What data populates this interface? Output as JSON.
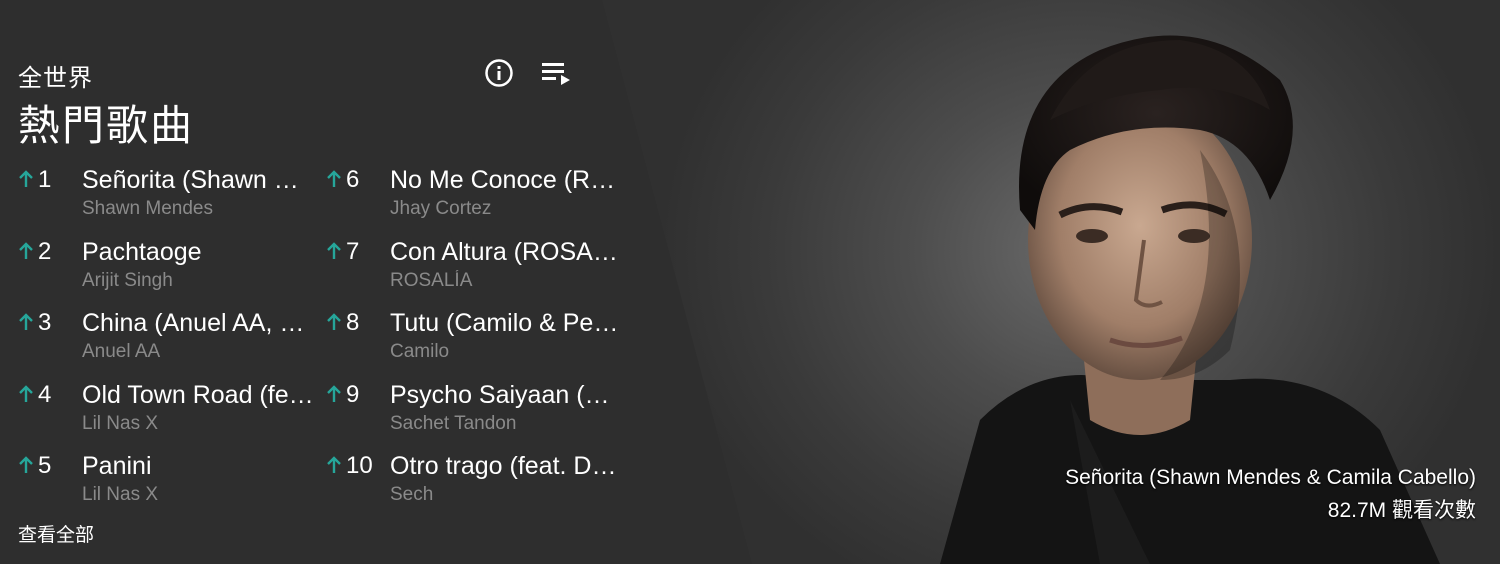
{
  "header": {
    "region": "全世界",
    "title": "熱門歌曲"
  },
  "icons": {
    "info": "info-icon",
    "queue": "playlist-play-icon",
    "rank_change": "arrow-up-icon"
  },
  "colors": {
    "panel": "#2e2e2e",
    "rank_up": "#26a69a",
    "artist_text": "#8a8a8a"
  },
  "chart": [
    {
      "rank": "1",
      "title": "Señorita (Shawn Mendes & Camila Cabello)",
      "artist": "Shawn Mendes"
    },
    {
      "rank": "2",
      "title": "Pachtaoge",
      "artist": "Arijit Singh"
    },
    {
      "rank": "3",
      "title": "China (Anuel AA, Daddy Yankee, Karol G, Ozuna & J Balvin)",
      "artist": "Anuel AA"
    },
    {
      "rank": "4",
      "title": "Old Town Road (feat. Billy Ray Cyrus)",
      "artist": "Lil Nas X"
    },
    {
      "rank": "5",
      "title": "Panini",
      "artist": "Lil Nas X"
    },
    {
      "rank": "6",
      "title": "No Me Conoce (Remix)",
      "artist": "Jhay Cortez"
    },
    {
      "rank": "7",
      "title": "Con Altura (ROSALÍA, J Balvin)",
      "artist": "ROSALÍA"
    },
    {
      "rank": "8",
      "title": "Tutu (Camilo & Pedro Capó)",
      "artist": "Camilo"
    },
    {
      "rank": "9",
      "title": "Psycho Saiyaan (Saaho)",
      "artist": "Sachet Tandon"
    },
    {
      "rank": "10",
      "title": "Otro trago (feat. Darell)",
      "artist": "Sech"
    }
  ],
  "view_all": "查看全部",
  "featured": {
    "title": "Señorita (Shawn Mendes & Camila Cabello)",
    "views": "82.7M 觀看次數"
  }
}
